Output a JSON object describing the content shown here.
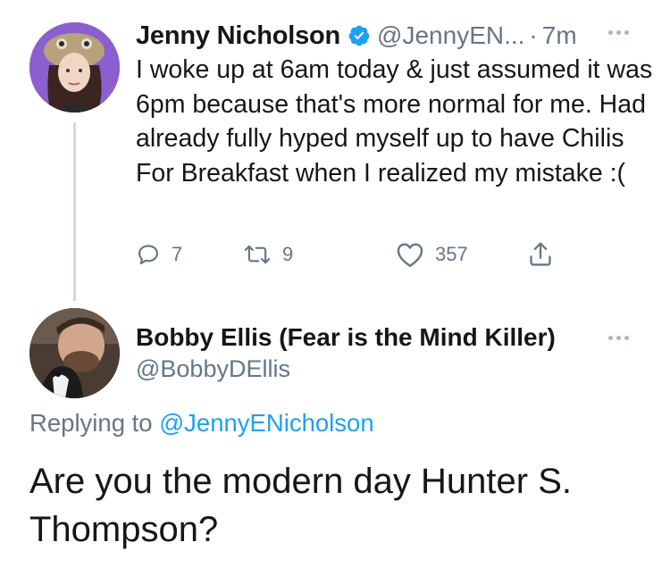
{
  "original_tweet": {
    "author_name": "Jenny Nicholson",
    "author_handle": "@JennyEN...",
    "separator": "·",
    "time": "7m",
    "text": "I woke up at 6am today & just assumed it was 6pm because that's more normal for me. Had already fully hyped myself up to have Chilis For Breakfast when I realized my mistake :(",
    "reply_count": "7",
    "retweet_count": "9",
    "like_count": "357",
    "verified": true
  },
  "reply_tweet": {
    "author_name": "Bobby Ellis (Fear is the Mind Killer)",
    "author_handle": "@BobbyDEllis",
    "replying_prefix": "Replying to",
    "replying_to": "@JennyENicholson",
    "text": "Are you the modern day Hunter S. Thompson?"
  },
  "colors": {
    "accent": "#1da1f2",
    "secondary_text": "#657786",
    "primary_text": "#14171a",
    "thread_line": "#cfd9de"
  },
  "icons": [
    "verified-badge-icon",
    "more-icon",
    "reply-icon",
    "retweet-icon",
    "like-icon",
    "share-icon"
  ]
}
